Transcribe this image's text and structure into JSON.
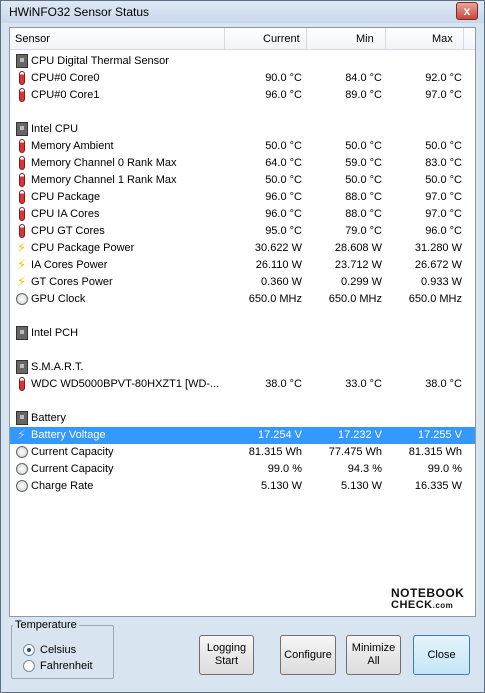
{
  "window": {
    "title": "HWiNFO32 Sensor Status",
    "close_glyph": "x"
  },
  "columns": [
    "Sensor",
    "Current",
    "Min",
    "Max"
  ],
  "rows": [
    {
      "icon": "chip-icon",
      "label": "CPU Digital Thermal Sensor",
      "current": "",
      "min": "",
      "max": "",
      "group": true
    },
    {
      "icon": "thermometer-icon",
      "label": "CPU#0 Core0",
      "current": "90.0 °C",
      "min": "84.0 °C",
      "max": "92.0 °C"
    },
    {
      "icon": "thermometer-icon",
      "label": "CPU#0 Core1",
      "current": "96.0 °C",
      "min": "89.0 °C",
      "max": "97.0 °C"
    },
    {
      "blank": true
    },
    {
      "icon": "chip-icon",
      "label": "Intel CPU",
      "current": "",
      "min": "",
      "max": "",
      "group": true
    },
    {
      "icon": "thermometer-icon",
      "label": "Memory Ambient",
      "current": "50.0 °C",
      "min": "50.0 °C",
      "max": "50.0 °C"
    },
    {
      "icon": "thermometer-icon",
      "label": "Memory Channel 0 Rank Max",
      "current": "64.0 °C",
      "min": "59.0 °C",
      "max": "83.0 °C"
    },
    {
      "icon": "thermometer-icon",
      "label": "Memory Channel 1 Rank Max",
      "current": "50.0 °C",
      "min": "50.0 °C",
      "max": "50.0 °C"
    },
    {
      "icon": "thermometer-icon",
      "label": "CPU Package",
      "current": "96.0 °C",
      "min": "88.0 °C",
      "max": "97.0 °C"
    },
    {
      "icon": "thermometer-icon",
      "label": "CPU IA Cores",
      "current": "96.0 °C",
      "min": "88.0 °C",
      "max": "97.0 °C"
    },
    {
      "icon": "thermometer-icon",
      "label": "CPU GT Cores",
      "current": "95.0 °C",
      "min": "79.0 °C",
      "max": "96.0 °C"
    },
    {
      "icon": "bolt-icon",
      "label": "CPU Package Power",
      "current": "30.622 W",
      "min": "28.608 W",
      "max": "31.280 W"
    },
    {
      "icon": "bolt-icon",
      "label": "IA Cores Power",
      "current": "26.110 W",
      "min": "23.712 W",
      "max": "26.672 W"
    },
    {
      "icon": "bolt-icon",
      "label": "GT Cores Power",
      "current": "0.360 W",
      "min": "0.299 W",
      "max": "0.933 W"
    },
    {
      "icon": "gauge-icon",
      "label": "GPU Clock",
      "current": "650.0  MHz",
      "min": "650.0  MHz",
      "max": "650.0  MHz"
    },
    {
      "blank": true
    },
    {
      "icon": "chip-icon",
      "label": "Intel PCH",
      "current": "",
      "min": "",
      "max": "",
      "group": true
    },
    {
      "blank": true
    },
    {
      "icon": "chip-icon",
      "label": "S.M.A.R.T.",
      "current": "",
      "min": "",
      "max": "",
      "group": true
    },
    {
      "icon": "thermometer-icon",
      "label": "WDC WD5000BPVT-80HXZT1 [WD-...",
      "current": "38.0 °C",
      "min": "33.0 °C",
      "max": "38.0 °C"
    },
    {
      "blank": true
    },
    {
      "icon": "chip-icon",
      "label": "Battery",
      "current": "",
      "min": "",
      "max": "",
      "group": true
    },
    {
      "icon": "bolt-blue-icon",
      "label": "Battery Voltage",
      "current": "17.254 V",
      "min": "17.232 V",
      "max": "17.255 V",
      "selected": true
    },
    {
      "icon": "gauge-icon",
      "label": "Current Capacity",
      "current": "81.315 Wh",
      "min": "77.475 Wh",
      "max": "81.315 Wh"
    },
    {
      "icon": "gauge-icon",
      "label": "Current Capacity",
      "current": "99.0 %",
      "min": "94.3 %",
      "max": "99.0 %"
    },
    {
      "icon": "gauge-icon",
      "label": "Charge Rate",
      "current": "5.130 W",
      "min": "5.130 W",
      "max": "16.335 W"
    }
  ],
  "watermark": {
    "line1": "NOTEBOOK",
    "line2": "CHECK",
    "line2_suffix": ".com"
  },
  "temperature": {
    "title": "Temperature",
    "options": [
      "Celsius",
      "Fahrenheit"
    ],
    "selected": "Celsius"
  },
  "buttons": {
    "logging": [
      "Logging",
      "Start"
    ],
    "configure": "Configure",
    "minimize": [
      "Minimize",
      "All"
    ],
    "close": "Close"
  }
}
